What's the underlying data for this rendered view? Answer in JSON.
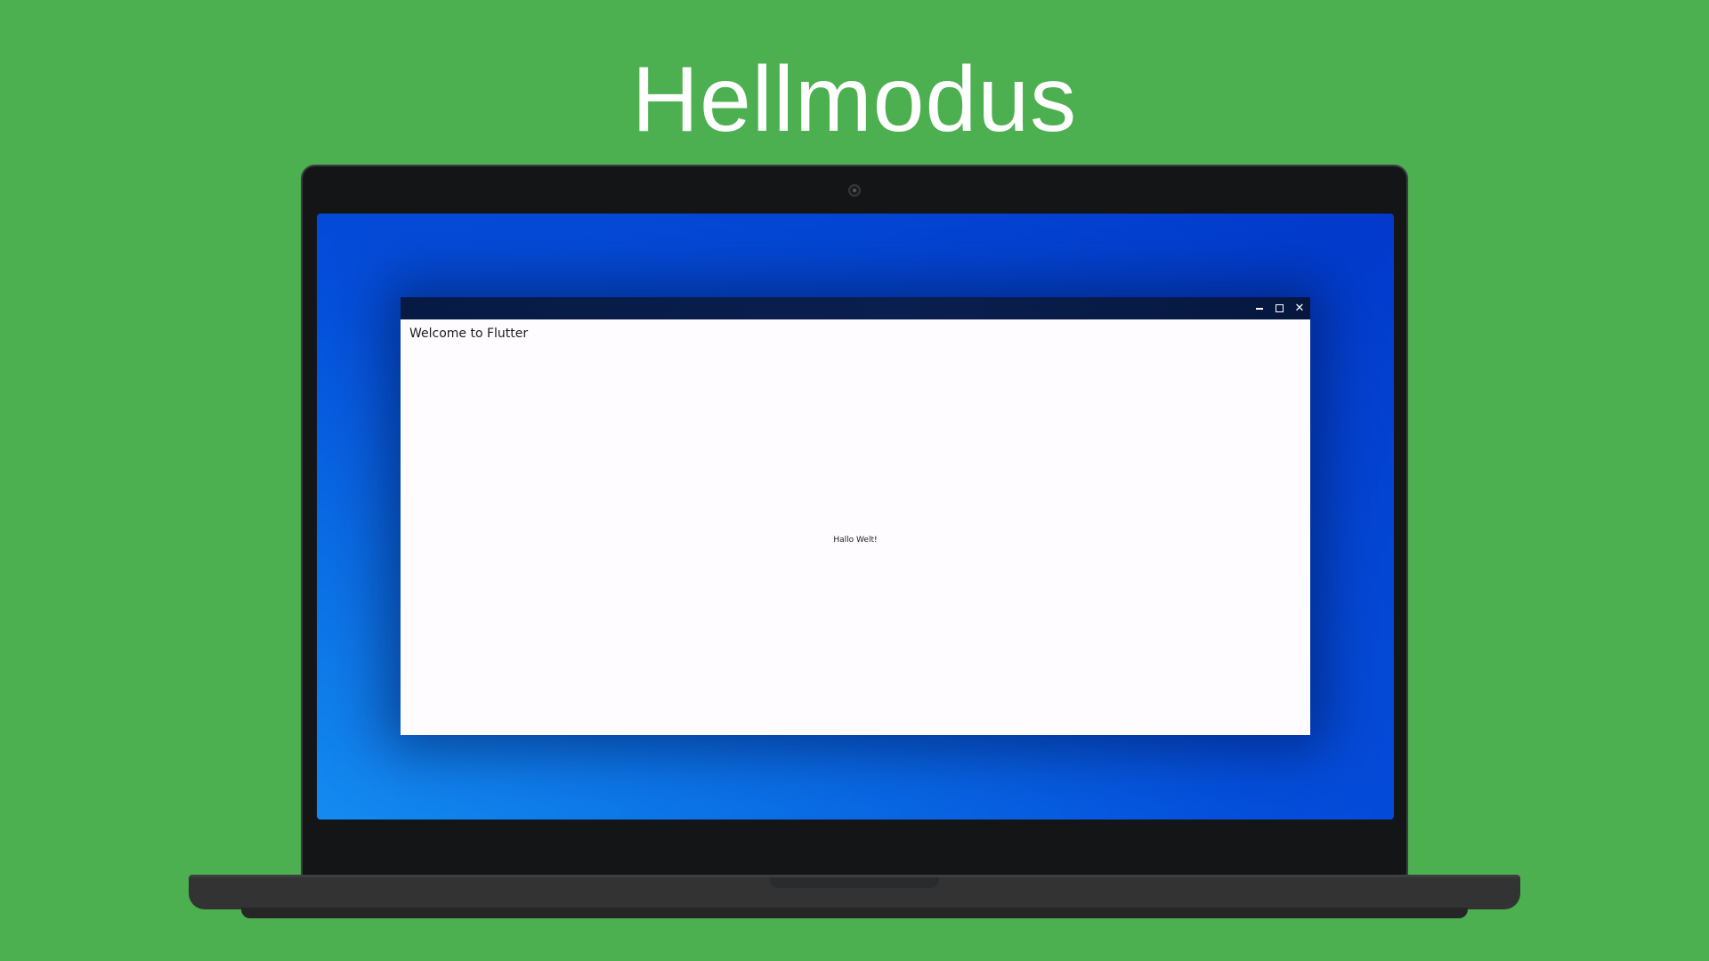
{
  "headline": "Hellmodus",
  "app": {
    "title": "Welcome to Flutter",
    "body_text": "Hallo Welt!"
  },
  "window_controls": {
    "minimize_icon": "minimize-icon",
    "maximize_icon": "maximize-icon",
    "close_icon": "close-icon"
  },
  "colors": {
    "background": "#4caf50",
    "titlebar": "#0a1f4f",
    "window_background": "#fffcff",
    "wallpaper": "#0550dc"
  }
}
